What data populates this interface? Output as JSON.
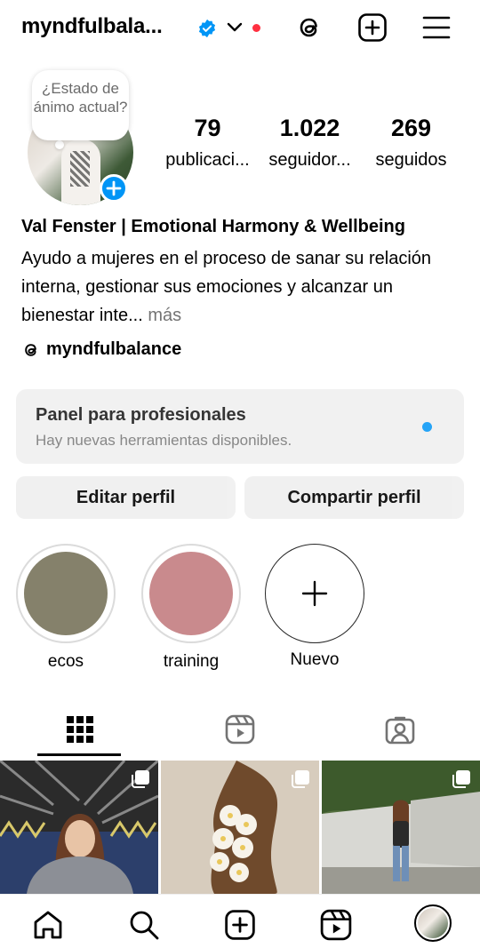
{
  "header": {
    "username": "myndfulbala...",
    "accent": "#0095f6",
    "alert_color": "#ff3040"
  },
  "profile": {
    "mood_bubble": "¿Estado de ánimo actual?",
    "stats": [
      {
        "num": "79",
        "label": "publicaci..."
      },
      {
        "num": "1.022",
        "label": "seguidor..."
      },
      {
        "num": "269",
        "label": "seguidos"
      }
    ],
    "name": "Val Fenster | Emotional Harmony & Wellbeing",
    "bio": "Ayudo a mujeres en el proceso de sanar su relación interna, gestionar sus emociones y alcanzar un bienestar inte...",
    "more": "más",
    "threads_handle": "myndfulbalance"
  },
  "pro_dashboard": {
    "title": "Panel para profesionales",
    "subtitle": "Hay nuevas herramientas disponibles."
  },
  "buttons": {
    "edit": "Editar perfil",
    "share": "Compartir perfil"
  },
  "highlights": [
    {
      "label": "ecos",
      "color": "#85816b"
    },
    {
      "label": "training",
      "color": "#c98a8d"
    },
    {
      "label": "Nuevo",
      "icon": "plus-icon"
    }
  ],
  "tabs": [
    "grid-icon",
    "reels-icon",
    "tagged-icon"
  ],
  "bottom_nav": [
    "home-icon",
    "search-icon",
    "create-icon",
    "reels-icon",
    "profile-avatar"
  ]
}
